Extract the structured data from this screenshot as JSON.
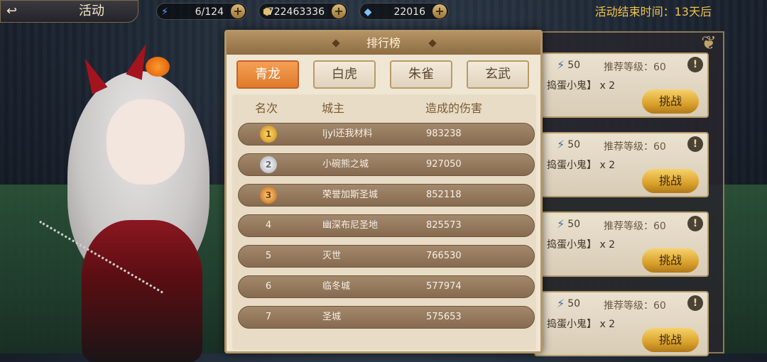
{
  "topbar": {
    "title": "活动",
    "resources": [
      {
        "icon": "energy-icon",
        "value": "6/124"
      },
      {
        "icon": "coin-icon",
        "value": "722463336"
      },
      {
        "icon": "gem-icon",
        "value": "22016"
      }
    ],
    "event_end": "活动结束时间：13天后"
  },
  "modal": {
    "title": "排行榜",
    "tabs": [
      "青龙",
      "白虎",
      "朱雀",
      "玄武"
    ],
    "active_tab": "青龙",
    "columns": [
      "名次",
      "城主",
      "造成的伤害"
    ],
    "rows": [
      {
        "rank": "1",
        "lord": "ljyl还我材料",
        "damage": "983238"
      },
      {
        "rank": "2",
        "lord": "小碗熊之城",
        "damage": "927050"
      },
      {
        "rank": "3",
        "lord": "荣誉加斯圣城",
        "damage": "852118"
      },
      {
        "rank": "4",
        "lord": "幽深布尼圣地",
        "damage": "825573"
      },
      {
        "rank": "5",
        "lord": "灭世",
        "damage": "766530"
      },
      {
        "rank": "6",
        "lord": "临冬城",
        "damage": "577974"
      },
      {
        "rank": "7",
        "lord": "圣城",
        "damage": "575653"
      }
    ]
  },
  "cards": [
    {
      "energy": "50",
      "recommend": "推荐等级：60",
      "name": "捣蛋小鬼】 x 2",
      "fight": "挑战"
    },
    {
      "energy": "50",
      "recommend": "推荐等级：60",
      "name": "捣蛋小鬼】 x 2",
      "fight": "挑战"
    },
    {
      "energy": "50",
      "recommend": "推荐等级：60",
      "name": "捣蛋小鬼】 x 2",
      "fight": "挑战"
    },
    {
      "energy": "50",
      "recommend": "推荐等级：60",
      "name": "捣蛋小鬼】 x 2",
      "fight": "挑战"
    }
  ]
}
